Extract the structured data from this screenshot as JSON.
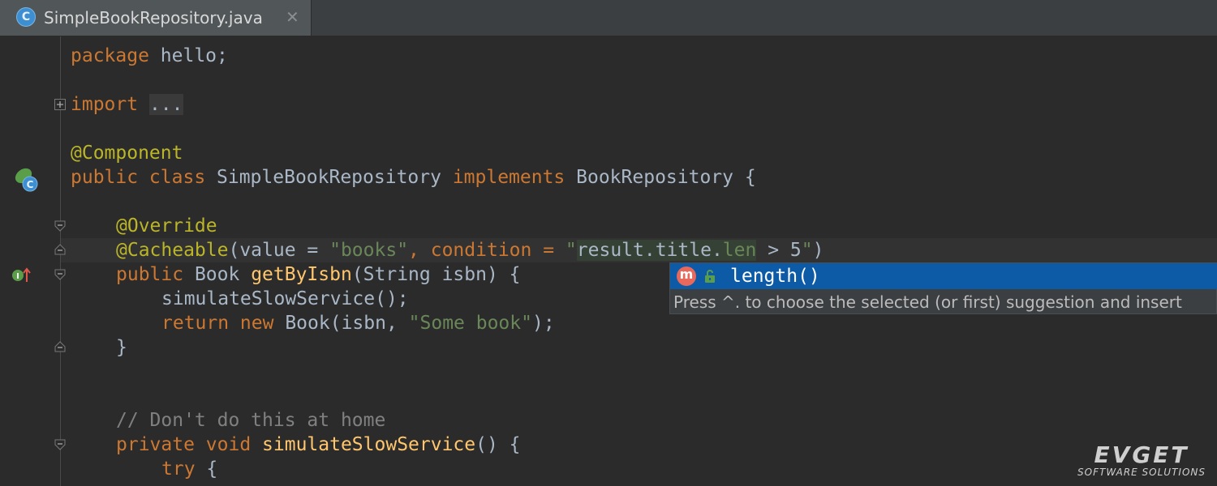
{
  "tab": {
    "icon_letter": "C",
    "title": "SimpleBookRepository.java",
    "close_glyph": "✕"
  },
  "code": {
    "l1_kw": "package",
    "l1_rest": " hello;",
    "l2_kw": "import",
    "l2_fold": "...",
    "l3_ann": "@Component",
    "l4_kw": "public class",
    "l4_name": " SimpleBookRepository ",
    "l4_kw2": "implements",
    "l4_rest": " BookRepository {",
    "l5_ann": "@Override",
    "l6_ann": "@Cacheable",
    "l6_a": "(value = ",
    "l6_s1": "\"books\"",
    "l6_b": ", condition = ",
    "l6_q": "\"",
    "l6_c": "result.title.",
    "l6_d": "len",
    "l6_e": " > 5",
    "l6_q2": "\"",
    "l6_f": ")",
    "l7_kw": "public",
    "l7_a": " Book ",
    "l7_fn": "getByIsbn",
    "l7_b": "(String isbn) {",
    "l8": "simulateSlowService();",
    "l9_kw": "return new",
    "l9_a": " Book(isbn, ",
    "l9_s": "\"Some book\"",
    "l9_b": ");",
    "l10": "}",
    "l11_cm": "// Don't do this at home",
    "l12_kw": "private void",
    "l12_sp": " ",
    "l12_fn": "simulateSlowService",
    "l12_b": "() {",
    "l13_kw": "try",
    "l13_b": " {"
  },
  "completion": {
    "icon_letter": "m",
    "suggestion": "length()",
    "hint": "Press ^. to choose the selected (or first) suggestion and insert"
  },
  "watermark": {
    "logo": "EVGET",
    "sub": "SOFTWARE SOLUTIONS"
  }
}
